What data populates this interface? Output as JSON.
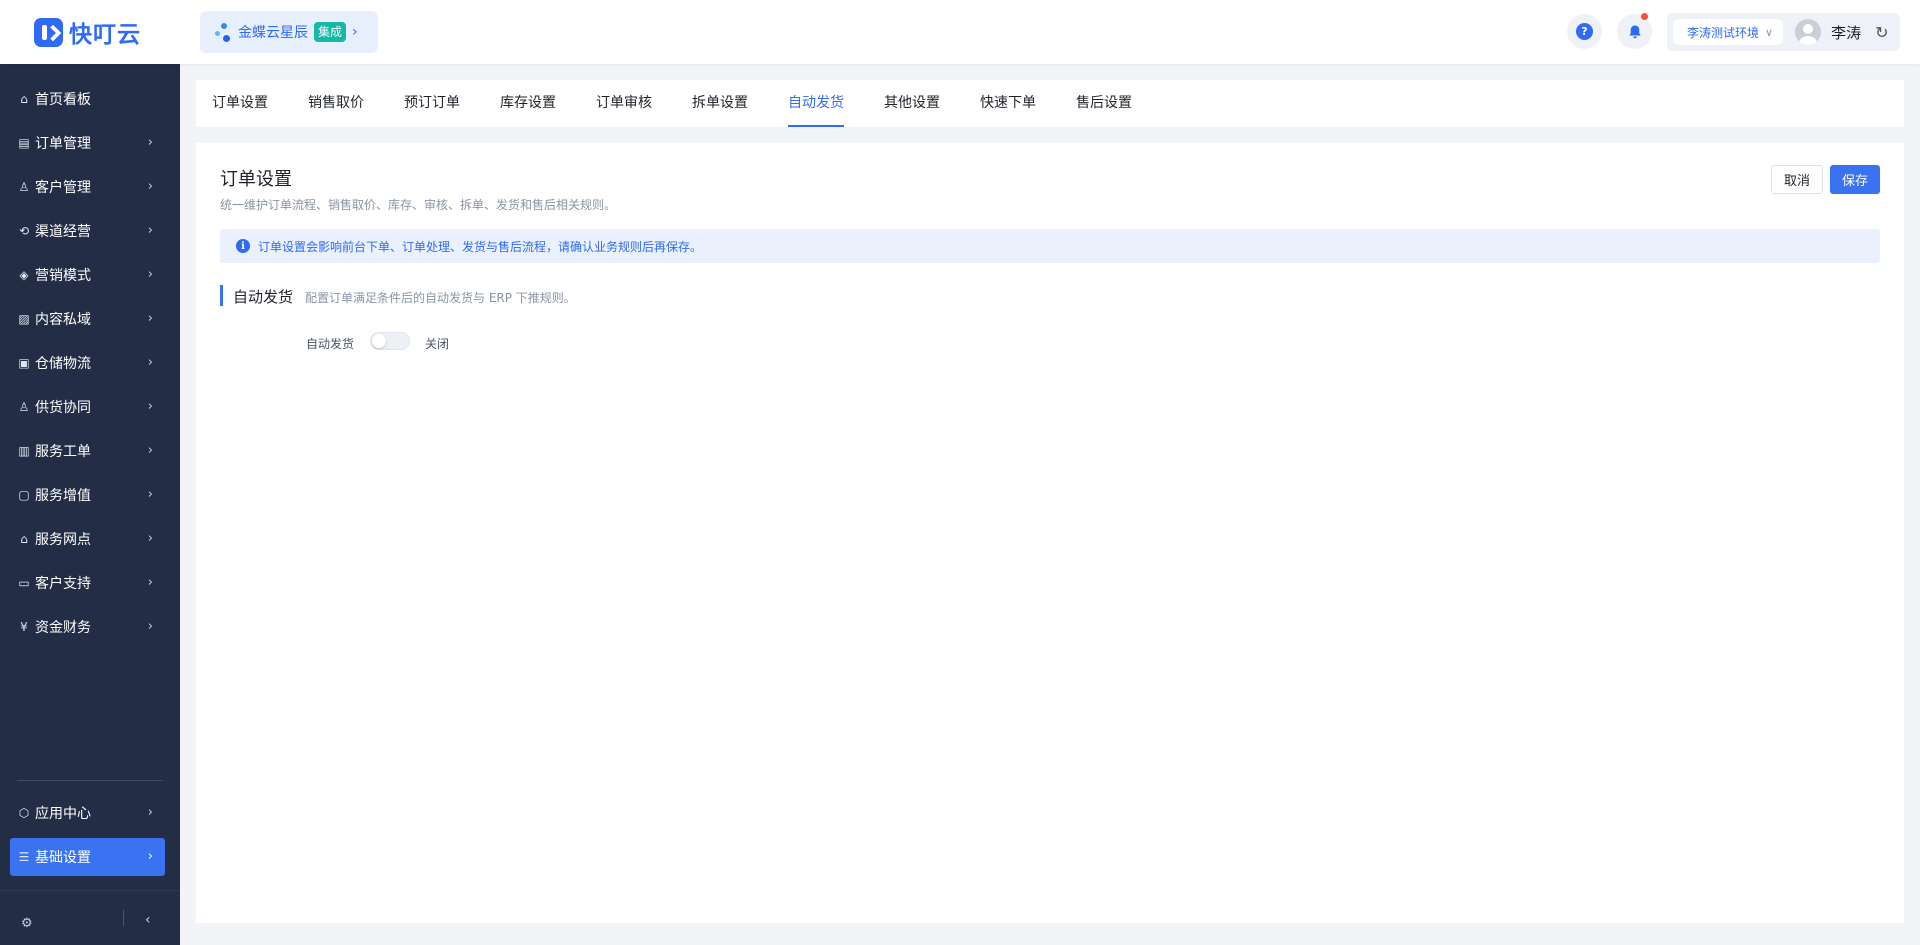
{
  "app": {
    "brand": "快叮云"
  },
  "org": {
    "name": "金蝶云星辰",
    "tag": "集成"
  },
  "header": {
    "env": "李涛测试环境",
    "user": "李涛"
  },
  "sidebar": {
    "items": [
      {
        "label": "首页看板",
        "icon": "home-icon"
      },
      {
        "label": "订单管理",
        "icon": "order-icon"
      },
      {
        "label": "客户管理",
        "icon": "user-icon"
      },
      {
        "label": "渠道经营",
        "icon": "channel-icon"
      },
      {
        "label": "营销模式",
        "icon": "tag-icon"
      },
      {
        "label": "内容私域",
        "icon": "image-icon"
      },
      {
        "label": "仓储物流",
        "icon": "box-icon"
      },
      {
        "label": "供货协同",
        "icon": "supply-icon"
      },
      {
        "label": "服务工单",
        "icon": "ticket-icon"
      },
      {
        "label": "服务增值",
        "icon": "bag-icon"
      },
      {
        "label": "服务网点",
        "icon": "store-icon"
      },
      {
        "label": "客户支持",
        "icon": "support-icon"
      },
      {
        "label": "资金财务",
        "icon": "yen-icon"
      }
    ],
    "bottom_items": [
      {
        "label": "应用中心",
        "icon": "cube-icon"
      },
      {
        "label": "基础设置",
        "icon": "settings-icon",
        "active": true
      }
    ]
  },
  "tabs": [
    {
      "label": "订单设置"
    },
    {
      "label": "销售取价"
    },
    {
      "label": "预订订单"
    },
    {
      "label": "库存设置"
    },
    {
      "label": "订单审核"
    },
    {
      "label": "拆单设置"
    },
    {
      "label": "自动发货",
      "active": true
    },
    {
      "label": "其他设置"
    },
    {
      "label": "快速下单"
    },
    {
      "label": "售后设置"
    }
  ],
  "main": {
    "title": "订单设置",
    "description": "统一维护订单流程、销售取价、库存、审核、拆单、发货和售后相关规则。",
    "cancel_label": "取消",
    "save_label": "保存",
    "info": "订单设置会影响前台下单、订单处理、发货与售后流程，请确认业务规则后再保存。",
    "section": {
      "title": "自动发货",
      "description": "配置订单满足条件后的自动发货与 ERP 下推规则。",
      "field_label": "自动发货",
      "toggle_on": false,
      "toggle_state": "关闭"
    }
  },
  "colors": {
    "accent": "#3a73f2",
    "sidebar_bg": "#232d45",
    "page_bg": "#f2f4f7"
  }
}
